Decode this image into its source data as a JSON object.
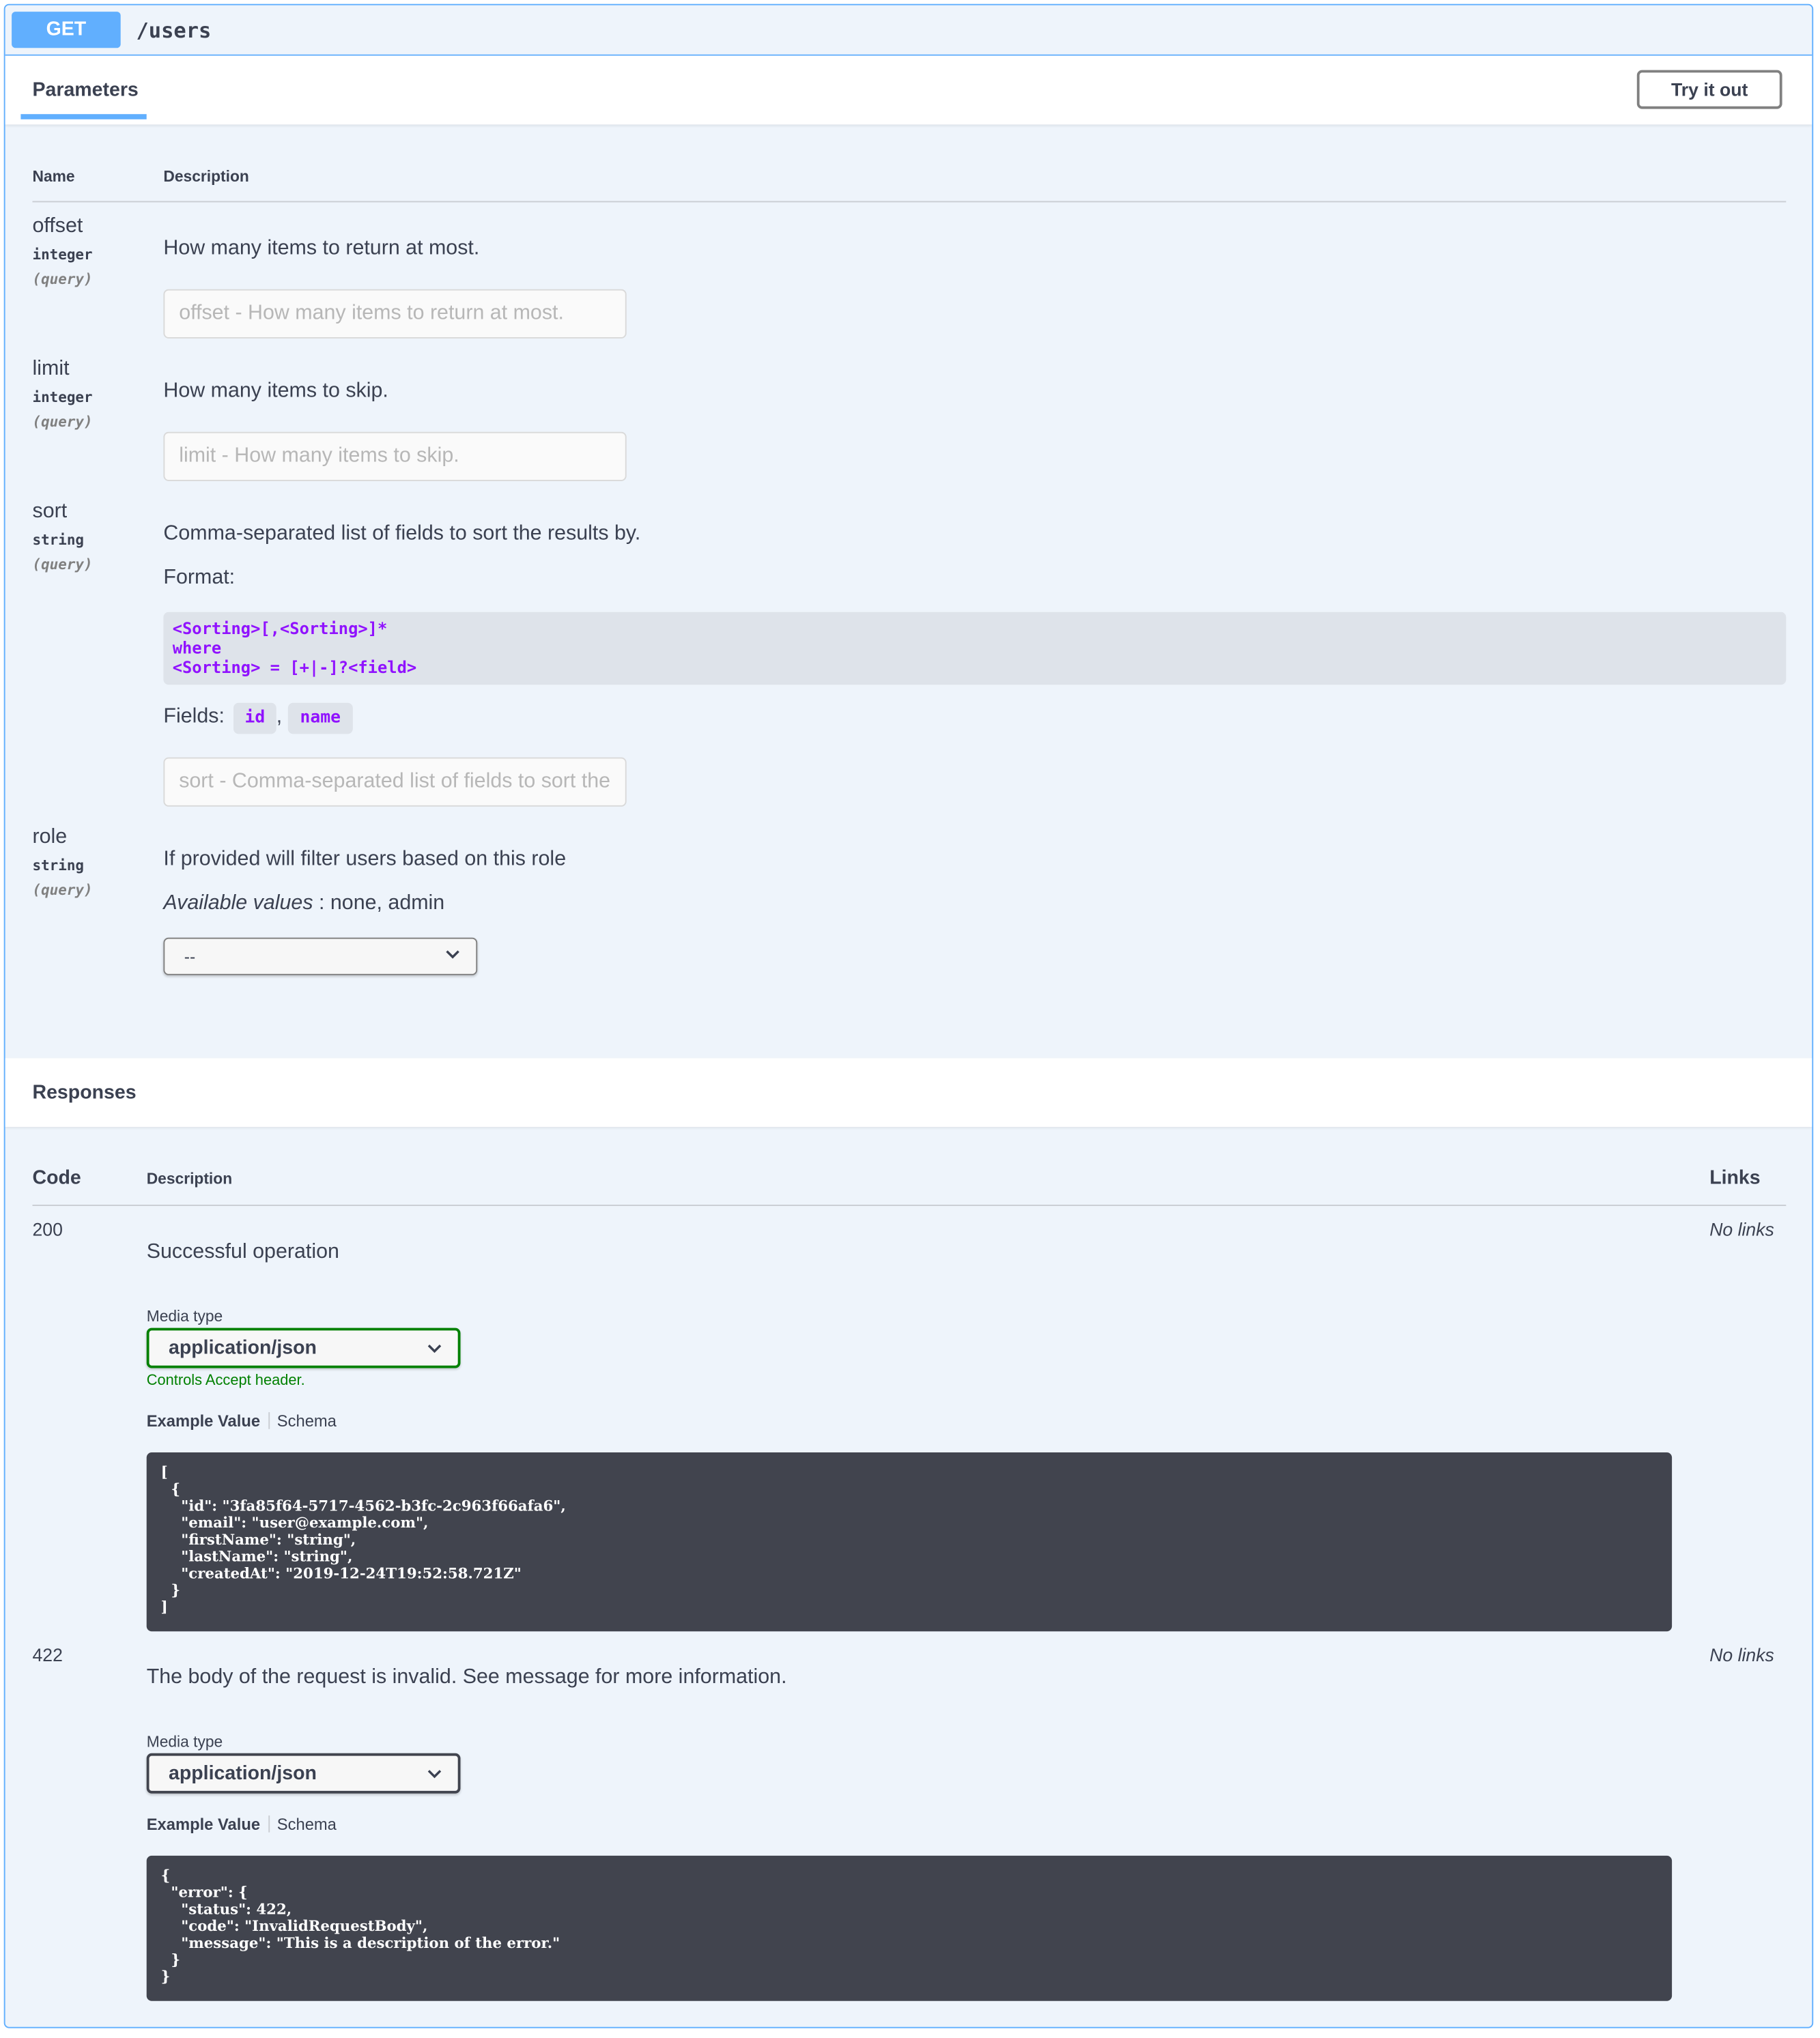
{
  "operation": {
    "method": "GET",
    "path": "/users"
  },
  "parameters_section": {
    "title": "Parameters",
    "try_button": "Try it out",
    "col_name": "Name",
    "col_description": "Description",
    "params": [
      {
        "name": "offset",
        "type": "integer",
        "in": "(query)",
        "description": "How many items to return at most.",
        "placeholder": "offset - How many items to return at most."
      },
      {
        "name": "limit",
        "type": "integer",
        "in": "(query)",
        "description": "How many items to skip.",
        "placeholder": "limit - How many items to skip."
      },
      {
        "name": "sort",
        "type": "string",
        "in": "(query)",
        "description": "Comma-separated list of fields to sort the results by.",
        "format_label": "Format:",
        "format_lines": [
          "<Sorting>[,<Sorting>]*",
          "where",
          "<Sorting> = [+|-]?<field>"
        ],
        "fields_label": "Fields:",
        "fields": [
          "id",
          "name"
        ],
        "fields_sep": ",",
        "placeholder": "sort - Comma-separated list of fields to sort the results by."
      },
      {
        "name": "role",
        "type": "string",
        "in": "(query)",
        "description": "If provided will filter users based on this role",
        "available_label": "Available values",
        "available_values": " : none, admin",
        "select_value": "--"
      }
    ]
  },
  "responses_section": {
    "title": "Responses",
    "col_code": "Code",
    "col_description": "Description",
    "col_links": "Links",
    "responses": [
      {
        "code": "200",
        "description": "Successful operation",
        "links": "No links",
        "media_label": "Media type",
        "media_value": "application/json",
        "media_hint": "Controls Accept header.",
        "tab_example": "Example Value",
        "tab_schema": "Schema",
        "example": "[\n  {\n    \"id\": \"3fa85f64-5717-4562-b3fc-2c963f66afa6\",\n    \"email\": \"user@example.com\",\n    \"firstName\": \"string\",\n    \"lastName\": \"string\",\n    \"createdAt\": \"2019-12-24T19:52:58.721Z\"\n  }\n]"
      },
      {
        "code": "422",
        "description": "The body of the request is invalid. See message for more information.",
        "links": "No links",
        "media_label": "Media type",
        "media_value": "application/json",
        "tab_example": "Example Value",
        "tab_schema": "Schema",
        "example": "{\n  \"error\": {\n    \"status\": 422,\n    \"code\": \"InvalidRequestBody\",\n    \"message\": \"This is a description of the error.\"\n  }\n}"
      }
    ]
  },
  "colors": {
    "get_method": "#61affe",
    "accent_green": "#008000",
    "code_purple": "#9012fe",
    "code_bg": "#41444e"
  }
}
